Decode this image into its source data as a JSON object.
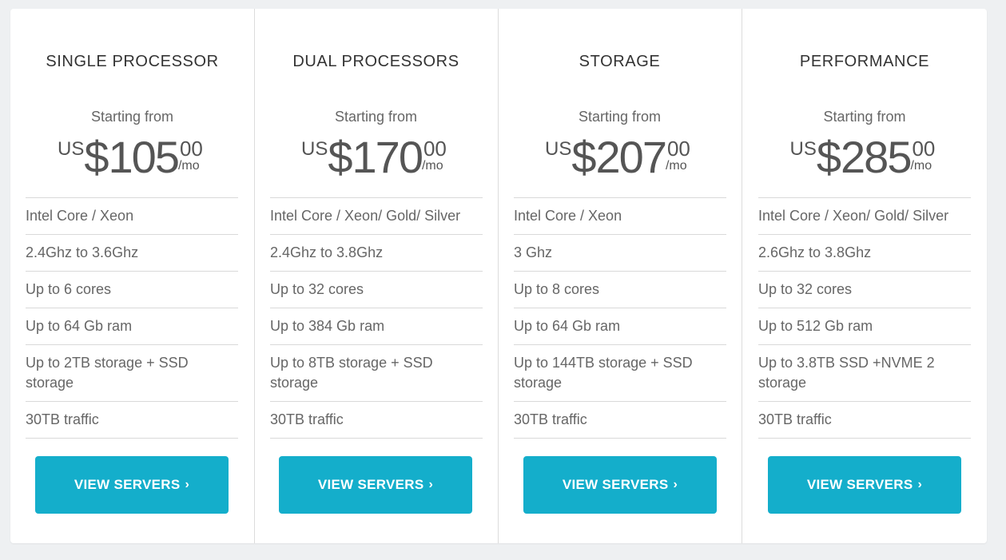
{
  "plans": [
    {
      "title": "SINGLE PROCESSOR",
      "starting": "Starting from",
      "currency": "US",
      "dollar": "$",
      "amount": "105",
      "cents": "00",
      "period": "/mo",
      "features": [
        "Intel Core / Xeon",
        "2.4Ghz to 3.6Ghz",
        "Up to 6 cores",
        "Up to 64 Gb ram",
        "Up to 2TB storage + SSD storage",
        "30TB traffic"
      ],
      "button_label": "VIEW SERVERS",
      "button_icon": "chevron-right-icon",
      "button_glyph": "›"
    },
    {
      "title": "DUAL PROCESSORS",
      "starting": "Starting from",
      "currency": "US",
      "dollar": "$",
      "amount": "170",
      "cents": "00",
      "period": "/mo",
      "features": [
        "Intel Core / Xeon/ Gold/ Silver",
        "2.4Ghz to 3.8Ghz",
        "Up to 32 cores",
        "Up to 384 Gb ram",
        "Up to 8TB storage + SSD storage",
        "30TB traffic"
      ],
      "button_label": "VIEW SERVERS",
      "button_icon": "chevron-right-icon",
      "button_glyph": "›"
    },
    {
      "title": "STORAGE",
      "starting": "Starting from",
      "currency": "US",
      "dollar": "$",
      "amount": "207",
      "cents": "00",
      "period": "/mo",
      "features": [
        "Intel Core / Xeon",
        "3 Ghz",
        "Up to 8 cores",
        "Up to 64 Gb ram",
        "Up to 144TB storage + SSD storage",
        "30TB traffic"
      ],
      "button_label": "VIEW SERVERS",
      "button_icon": "chevron-right-icon",
      "button_glyph": "›"
    },
    {
      "title": "PERFORMANCE",
      "starting": "Starting from",
      "currency": "US",
      "dollar": "$",
      "amount": "285",
      "cents": "00",
      "period": "/mo",
      "features": [
        "Intel Core / Xeon/ Gold/ Silver",
        "2.6Ghz to 3.8Ghz",
        "Up to 32 cores",
        "Up to 512 Gb ram",
        "Up to 3.8TB SSD +NVME 2 storage",
        "30TB traffic"
      ],
      "button_label": "VIEW SERVERS",
      "button_icon": "chevron-right-icon",
      "button_glyph": "›"
    }
  ],
  "colors": {
    "accent": "#14aecb",
    "background": "#eef0f2",
    "card": "#ffffff"
  }
}
